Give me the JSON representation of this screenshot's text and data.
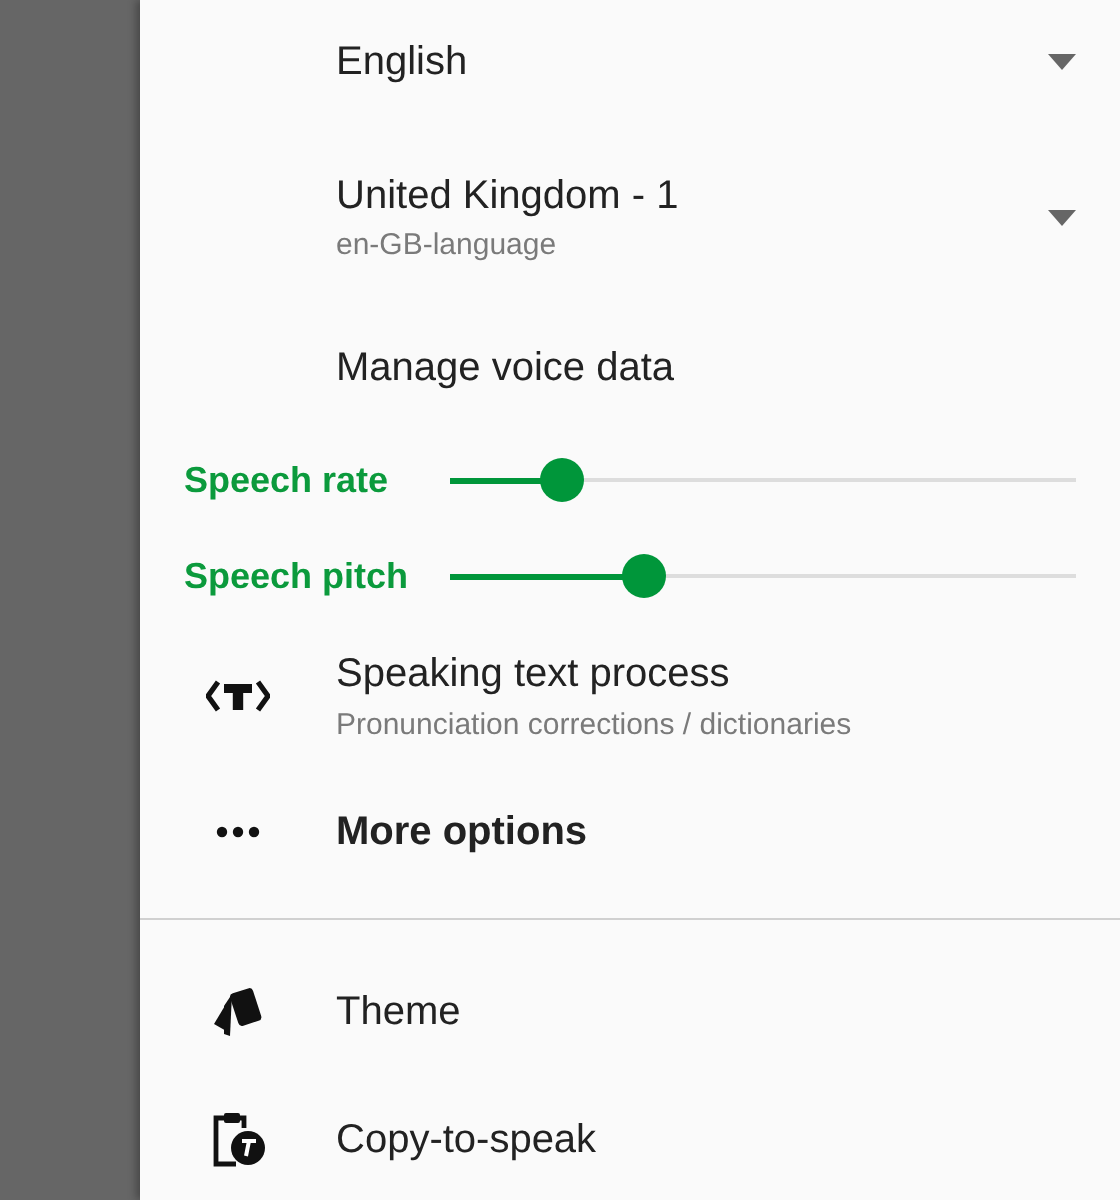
{
  "dropdowns": [
    {
      "value": "English"
    },
    {
      "value": "United Kingdom - 1",
      "subtitle": "en-GB-language"
    }
  ],
  "manage_voice_data": "Manage voice data",
  "sliders": [
    {
      "label": "Speech rate",
      "level": 0.18
    },
    {
      "label": "Speech pitch",
      "level": 0.31
    }
  ],
  "options": [
    {
      "kind": "text-process",
      "title": "Speaking text process",
      "subtitle": "Pronunciation corrections / dictionaries"
    },
    {
      "kind": "more",
      "title": "More options"
    }
  ],
  "menu": [
    {
      "kind": "theme",
      "title": "Theme"
    },
    {
      "kind": "copy",
      "title": "Copy-to-speak"
    }
  ]
}
